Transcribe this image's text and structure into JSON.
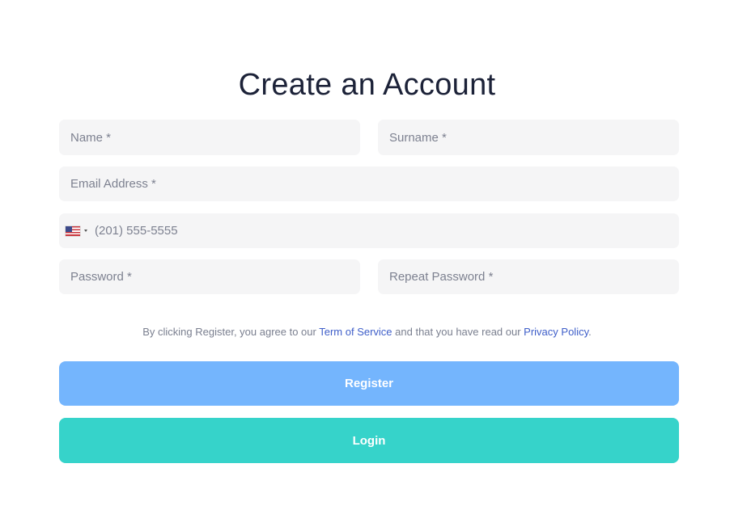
{
  "form": {
    "title": "Create an Account",
    "name_placeholder": "Name *",
    "surname_placeholder": "Surname *",
    "email_placeholder": "Email Address *",
    "phone": {
      "country_flag": "us-flag-icon",
      "placeholder": "(201) 555-5555"
    },
    "password_placeholder": "Password *",
    "repeat_password_placeholder": "Repeat Password *"
  },
  "terms": {
    "prefix": "By clicking Register, you agree to our ",
    "terms_link": "Term of Service",
    "middle": " and that you have read our ",
    "privacy_link": "Privacy Policy",
    "suffix": "."
  },
  "buttons": {
    "register_label": "Register",
    "login_label": "Login"
  },
  "colors": {
    "title": "#1c2238",
    "field_bg": "#f5f5f6",
    "link": "#3e5ec9",
    "register_bg": "#74b5fd",
    "login_bg": "#36d3ca"
  }
}
